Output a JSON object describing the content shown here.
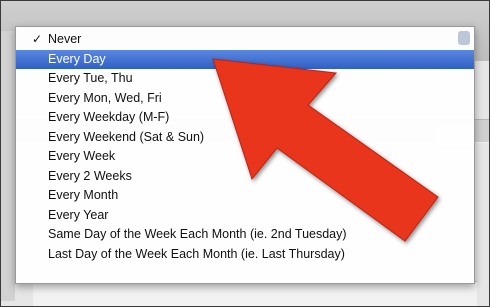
{
  "menu": {
    "checked_index": 0,
    "selected_index": 1,
    "items": [
      {
        "label": "Never"
      },
      {
        "label": "Every Day"
      },
      {
        "label": "Every Tue, Thu"
      },
      {
        "label": "Every Mon, Wed, Fri"
      },
      {
        "label": "Every Weekday (M-F)"
      },
      {
        "label": "Every Weekend (Sat & Sun)"
      },
      {
        "label": "Every Week"
      },
      {
        "label": "Every 2 Weeks"
      },
      {
        "label": "Every Month"
      },
      {
        "label": "Every Year"
      },
      {
        "label": "Same Day of the Week Each Month (ie. 2nd Tuesday)"
      },
      {
        "label": "Last Day of the Week Each Month (ie. Last Thursday)"
      }
    ],
    "check_glyph": "✓"
  },
  "annotation": {
    "arrow_color": "#e8361f",
    "arrow_icon": "red-arrow-pointer"
  },
  "colors": {
    "highlight": "#3d6fd1"
  }
}
